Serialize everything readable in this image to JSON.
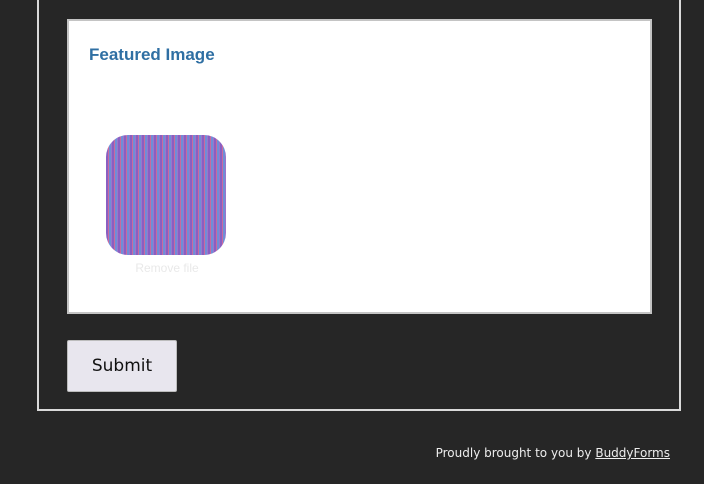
{
  "featured": {
    "title": "Featured Image",
    "thumbnail_caption": "Remove file"
  },
  "form": {
    "submit_label": "Submit"
  },
  "footer": {
    "prefix": "Proudly brought to you by ",
    "link_text": "BuddyForms"
  }
}
